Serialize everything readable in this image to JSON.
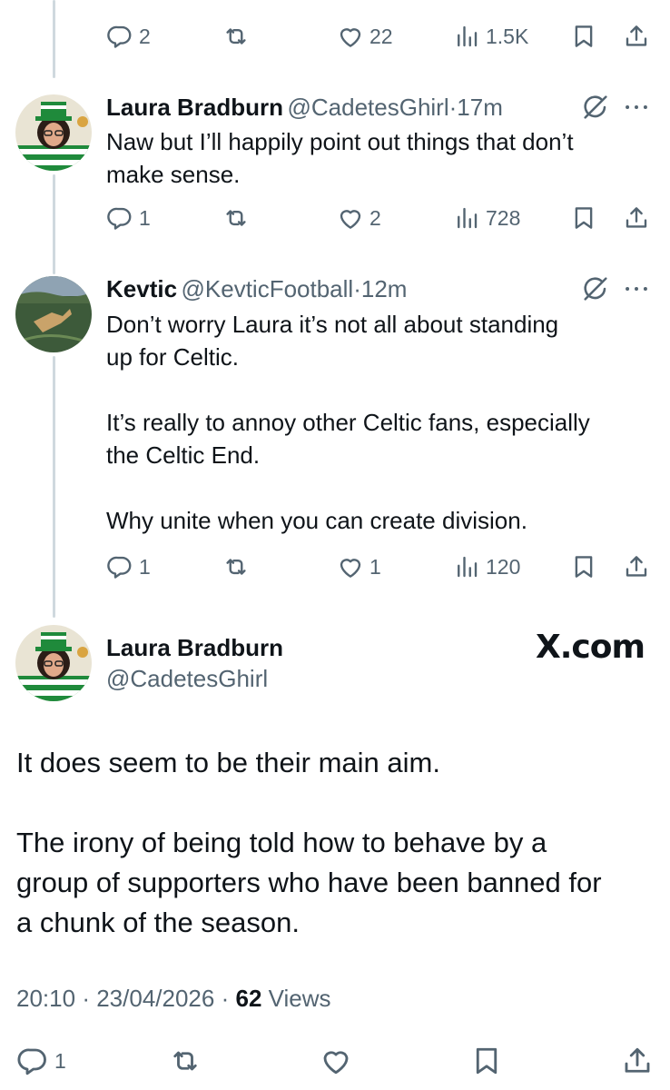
{
  "tweet0_stats": {
    "replies": "2",
    "views": "1.5K",
    "likes": "22"
  },
  "tweet1": {
    "name": "Laura Bradburn",
    "handle": "@CadetesGhirl",
    "time": "17m",
    "lines": [
      "Naw but I’ll happily point out things that don’t",
      "make sense."
    ],
    "replies": "1",
    "likes": "2",
    "views": "728"
  },
  "tweet2": {
    "name": "Kevtic",
    "handle": "@KevticFootball",
    "time": "12m",
    "lines": [
      "Don’t worry Laura it’s not all about standing",
      "up for Celtic.",
      "It’s really to annoy other Celtic fans, especially",
      "the Celtic End.",
      "Why unite when you can create division."
    ],
    "replies": "1",
    "likes": "1",
    "views": "120"
  },
  "main": {
    "name": "Laura Bradburn",
    "handle": "@CadetesGhirl",
    "watermark": "X.com",
    "lines": [
      "It does seem to be their main aim.",
      "The irony of being told how to behave by a",
      "group of supporters who have been banned for",
      "a chunk of the season."
    ],
    "time": "20:10",
    "date": "23/04/2026",
    "views_count": "62",
    "views_label": "Views",
    "replies": "1"
  },
  "separator": "·",
  "icons": {
    "reply": "reply-icon",
    "retweet": "retweet-icon",
    "like": "heart-icon",
    "views": "views-icon",
    "bookmark": "bookmark-icon",
    "share": "share-icon",
    "grok": "grok-icon",
    "more": "more-icon"
  },
  "colors": {
    "text": "#0f1419",
    "secondary": "#536471",
    "thread": "#cfd9de",
    "celtic_green": "#1f8a3b"
  }
}
